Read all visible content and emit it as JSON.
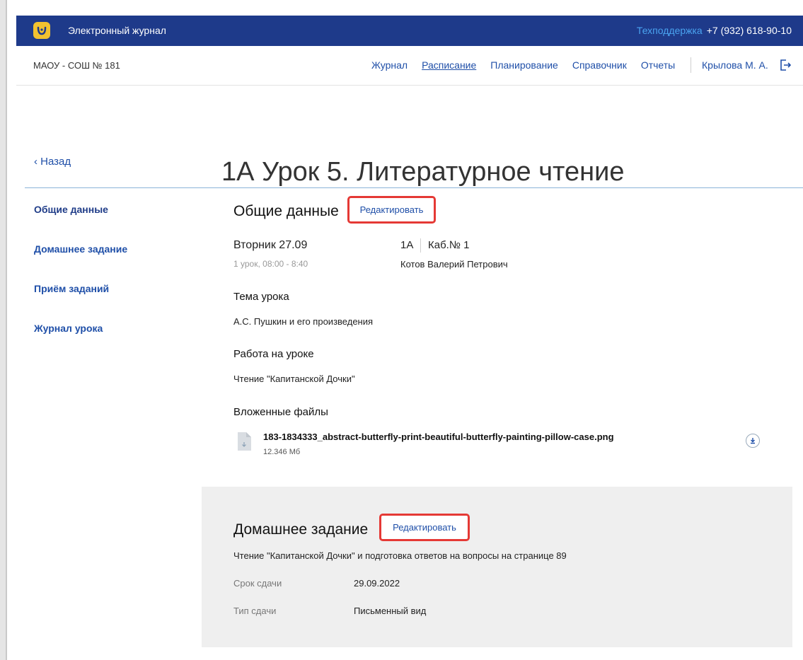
{
  "header": {
    "app_title": "Электронный журнал",
    "support_label": "Техподдержка",
    "support_phone": "+7 (932) 618-90-10"
  },
  "nav": {
    "school": "МАОУ - СОШ № 181",
    "menu": [
      "Журнал",
      "Расписание",
      "Планирование",
      "Справочник",
      "Отчеты"
    ],
    "active_item": "Расписание",
    "user": "Крылова М. А."
  },
  "page": {
    "back_label": "Назад",
    "title": "1А  Урок 5. Литературное чтение"
  },
  "sidebar": {
    "items": [
      "Общие данные",
      "Домашнее задание",
      "Приём заданий",
      "Журнал урока"
    ]
  },
  "general": {
    "heading": "Общие данные",
    "edit_label": "Редактировать",
    "date": "Вторник 27.09",
    "time": "1 урок, 08:00 - 8:40",
    "class": "1А",
    "room": "Каб.№ 1",
    "teacher": "Котов Валерий Петрович",
    "topic_label": "Тема урока",
    "topic": "А.С. Пушкин и его произведения",
    "work_label": "Работа на уроке",
    "work": "Чтение \"Капитанской Дочки\"",
    "files_label": "Вложенные файлы",
    "file_name": "183-1834333_abstract-butterfly-print-beautiful-butterfly-painting-pillow-case.png",
    "file_size": "12.346 Мб"
  },
  "homework": {
    "heading": "Домашнее задание",
    "edit_label": "Редактировать",
    "text": "Чтение \"Капитанской Дочки\" и подготовка ответов на вопросы на странице 89",
    "due_label": "Срок сдачи",
    "due": "29.09.2022",
    "type_label": "Тип сдачи",
    "type": "Письменный вид"
  },
  "colors": {
    "header_bg": "#1e3a8a",
    "link": "#1f4fa8",
    "highlight": "#e53935"
  }
}
